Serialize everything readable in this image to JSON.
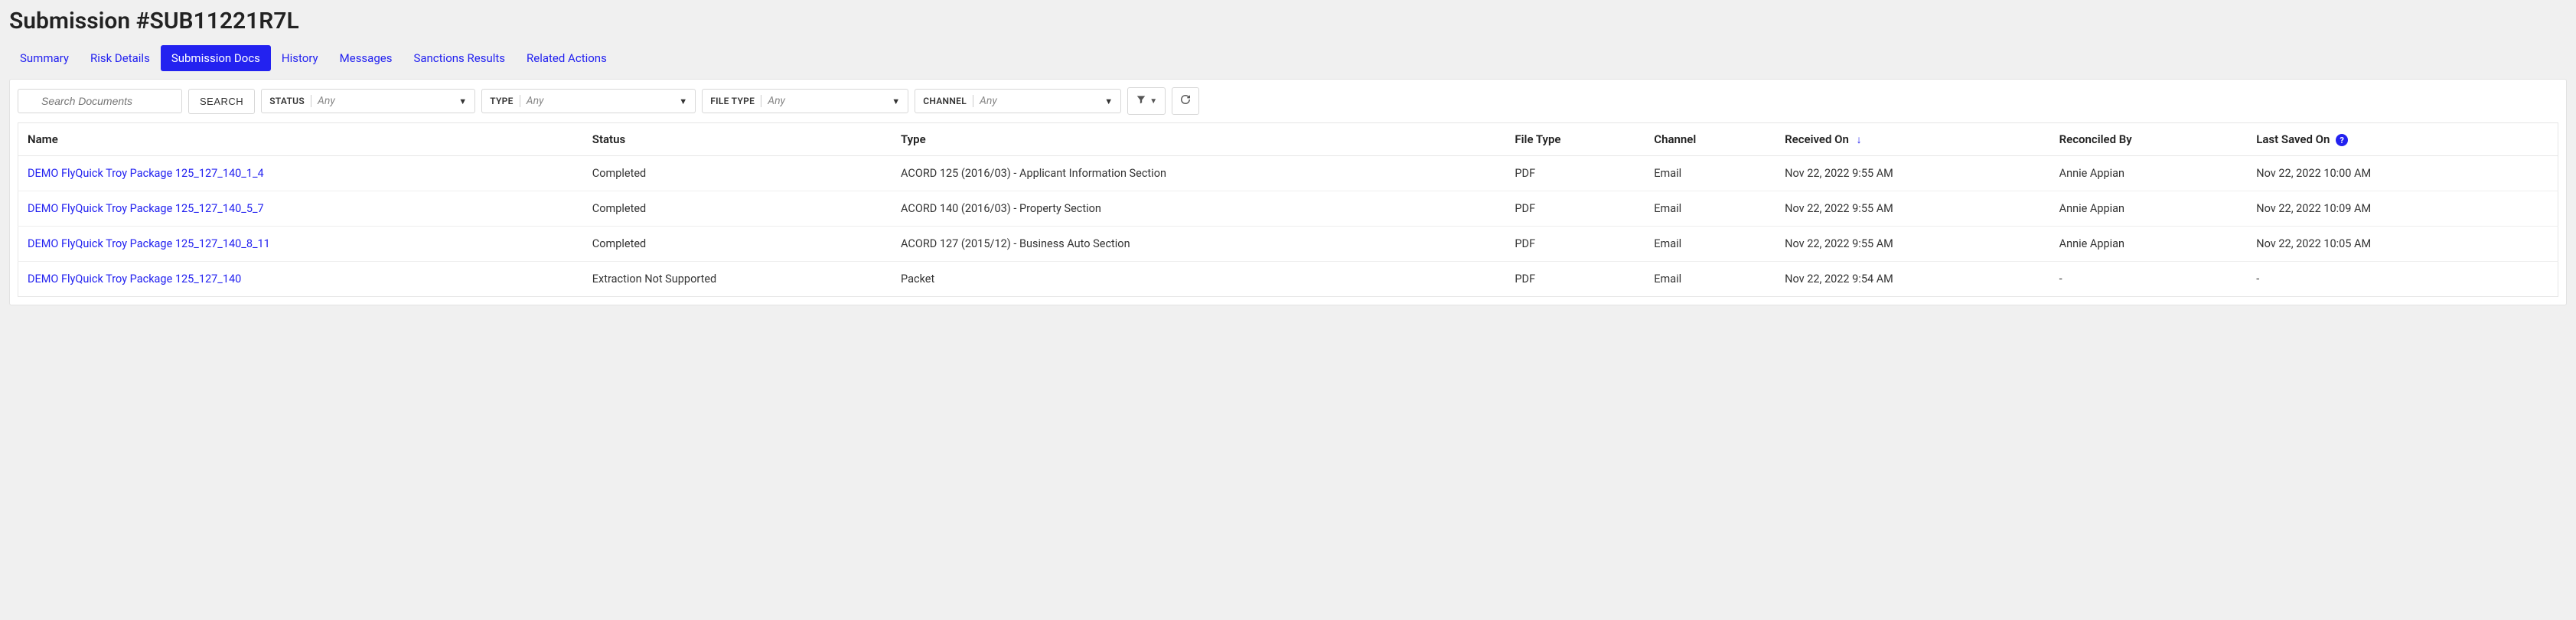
{
  "page_title": "Submission #SUB11221R7L",
  "tabs": [
    {
      "label": "Summary",
      "active": false
    },
    {
      "label": "Risk Details",
      "active": false
    },
    {
      "label": "Submission Docs",
      "active": true
    },
    {
      "label": "History",
      "active": false
    },
    {
      "label": "Messages",
      "active": false
    },
    {
      "label": "Sanctions Results",
      "active": false
    },
    {
      "label": "Related Actions",
      "active": false
    }
  ],
  "search": {
    "placeholder": "Search Documents",
    "button_label": "SEARCH"
  },
  "filters": {
    "status": {
      "label": "STATUS",
      "value": "Any"
    },
    "type": {
      "label": "TYPE",
      "value": "Any"
    },
    "filetype": {
      "label": "FILE TYPE",
      "value": "Any"
    },
    "channel": {
      "label": "CHANNEL",
      "value": "Any"
    }
  },
  "columns": {
    "name": "Name",
    "status": "Status",
    "type": "Type",
    "file_type": "File Type",
    "channel": "Channel",
    "received_on": "Received On",
    "reconciled_by": "Reconciled By",
    "last_saved_on": "Last Saved On"
  },
  "rows": [
    {
      "name": "DEMO FlyQuick Troy Package 125_127_140_1_4",
      "status": "Completed",
      "type": "ACORD 125 (2016/03) - Applicant Information Section",
      "file_type": "PDF",
      "channel": "Email",
      "received_on": "Nov 22, 2022 9:55 AM",
      "reconciled_by": "Annie Appian",
      "last_saved_on": "Nov 22, 2022 10:00 AM"
    },
    {
      "name": "DEMO FlyQuick Troy Package 125_127_140_5_7",
      "status": "Completed",
      "type": "ACORD 140 (2016/03) - Property Section",
      "file_type": "PDF",
      "channel": "Email",
      "received_on": "Nov 22, 2022 9:55 AM",
      "reconciled_by": "Annie Appian",
      "last_saved_on": "Nov 22, 2022 10:09 AM"
    },
    {
      "name": "DEMO FlyQuick Troy Package 125_127_140_8_11",
      "status": "Completed",
      "type": "ACORD 127 (2015/12) - Business Auto Section",
      "file_type": "PDF",
      "channel": "Email",
      "received_on": "Nov 22, 2022 9:55 AM",
      "reconciled_by": "Annie Appian",
      "last_saved_on": "Nov 22, 2022 10:05 AM"
    },
    {
      "name": "DEMO FlyQuick Troy Package 125_127_140",
      "status": "Extraction Not Supported",
      "type": "Packet",
      "file_type": "PDF",
      "channel": "Email",
      "received_on": "Nov 22, 2022 9:54 AM",
      "reconciled_by": "-",
      "last_saved_on": "-"
    }
  ]
}
